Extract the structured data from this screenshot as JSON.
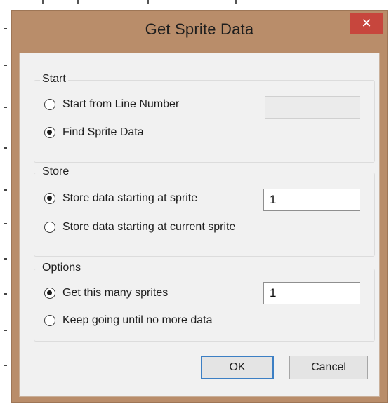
{
  "window": {
    "title": "Get Sprite Data",
    "close_glyph": "✕"
  },
  "start_group": {
    "label": "Start",
    "options": [
      {
        "label": "Start from Line Number",
        "checked": false
      },
      {
        "label": "Find Sprite Data",
        "checked": true
      }
    ],
    "line_number_value": ""
  },
  "store_group": {
    "label": "Store",
    "options": [
      {
        "label": "Store data starting at sprite",
        "checked": true
      },
      {
        "label": "Store data starting at current sprite",
        "checked": false
      }
    ],
    "sprite_value": "1"
  },
  "options_group": {
    "label": "Options",
    "options": [
      {
        "label": "Get this many sprites",
        "checked": true
      },
      {
        "label": "Keep going until no more data",
        "checked": false
      }
    ],
    "count_value": "1"
  },
  "buttons": {
    "ok": "OK",
    "cancel": "Cancel"
  },
  "colors": {
    "title_bar": "#b98d6a",
    "close_button": "#c7463d",
    "client_background": "#f1f1f1",
    "default_button_border": "#3c7fc4"
  }
}
